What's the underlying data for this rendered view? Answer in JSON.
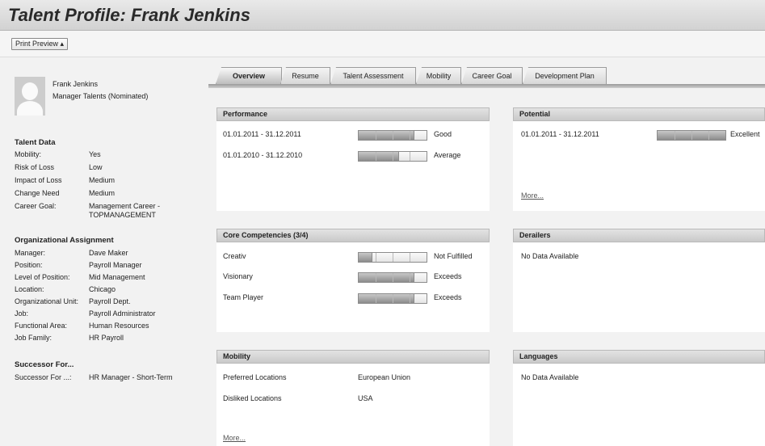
{
  "header": {
    "title": "Talent Profile: Frank Jenkins"
  },
  "toolbar": {
    "print_preview": "Print Preview ▴"
  },
  "person": {
    "name": "Frank Jenkins",
    "role": "Manager Talents (Nominated)"
  },
  "talent_data": {
    "title": "Talent Data",
    "rows": [
      {
        "label": "Mobility:",
        "value": "Yes"
      },
      {
        "label": "Risk of Loss",
        "value": "Low"
      },
      {
        "label": "Impact of Loss",
        "value": "Medium"
      },
      {
        "label": "Change Need",
        "value": "Medium"
      },
      {
        "label": "Career Goal:",
        "value": "Management Career - TOPMANAGEMENT"
      }
    ]
  },
  "org_assignment": {
    "title": "Organizational Assignment",
    "rows": [
      {
        "label": "Manager:",
        "value": "Dave Maker"
      },
      {
        "label": "Position:",
        "value": "Payroll Manager"
      },
      {
        "label": "Level of Position:",
        "value": "Mid Management"
      },
      {
        "label": "Location:",
        "value": "Chicago"
      },
      {
        "label": "Organizational Unit:",
        "value": "Payroll Dept."
      },
      {
        "label": "Job:",
        "value": "Payroll Administrator"
      },
      {
        "label": "Functional Area:",
        "value": "Human Resources"
      },
      {
        "label": "Job Family:",
        "value": "HR Payroll"
      }
    ]
  },
  "successor": {
    "title": "Successor For...",
    "rows": [
      {
        "label": "Successor For ...:",
        "value": "HR Manager - Short-Term"
      }
    ]
  },
  "tabs": [
    {
      "label": "Overview",
      "active": true
    },
    {
      "label": "Resume",
      "active": false
    },
    {
      "label": "Talent Assessment",
      "active": false
    },
    {
      "label": "Mobility",
      "active": false
    },
    {
      "label": "Career Goal",
      "active": false
    },
    {
      "label": "Development Plan",
      "active": false
    }
  ],
  "performance": {
    "title": "Performance",
    "rows": [
      {
        "period": "01.01.2011 - 31.12.2011",
        "rating": "Good",
        "level": 0.82
      },
      {
        "period": "01.01.2010 - 31.12.2010",
        "rating": "Average",
        "level": 0.6
      }
    ]
  },
  "potential": {
    "title": "Potential",
    "rows": [
      {
        "period": "01.01.2011 - 31.12.2011",
        "rating": "Excellent",
        "level": 1.0
      }
    ],
    "more": "More..."
  },
  "core_competencies": {
    "title": "Core Competencies (3/4)",
    "rows": [
      {
        "name": "Creativ",
        "rating": "Not Fulfilled",
        "level": 0.2
      },
      {
        "name": "Visionary",
        "rating": "Exceeds",
        "level": 0.82
      },
      {
        "name": "Team Player",
        "rating": "Exceeds",
        "level": 0.82
      }
    ]
  },
  "derailers": {
    "title": "Derailers",
    "empty": "No Data Available"
  },
  "mobility": {
    "title": "Mobility",
    "rows": [
      {
        "label": "Preferred Locations",
        "value": "European Union"
      },
      {
        "label": "Disliked Locations",
        "value": "USA"
      }
    ],
    "more": "More..."
  },
  "languages": {
    "title": "Languages",
    "empty": "No Data Available"
  },
  "colors": {
    "bar_fill": "#8c8c8c",
    "panel_header": "#d0d0d0",
    "background": "#f2f2f2"
  }
}
